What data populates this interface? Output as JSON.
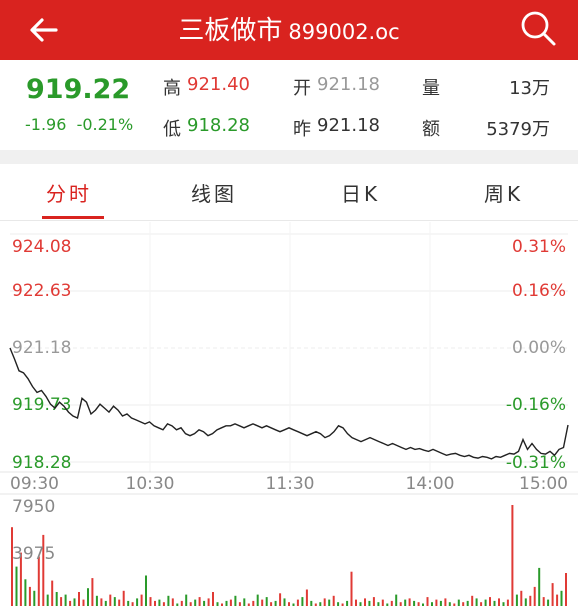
{
  "header": {
    "name": "三板做市",
    "code": "899002.oc"
  },
  "quote": {
    "price": "919.22",
    "change": "-1.96",
    "change_pct": "-0.21%",
    "high_label": "高",
    "high": "921.40",
    "low_label": "低",
    "low": "918.28",
    "open_label": "开",
    "open": "921.18",
    "prev_label": "昨",
    "prev": "921.18",
    "volume_label": "量",
    "volume": "13万",
    "amount_label": "额",
    "amount": "5379万"
  },
  "tabs": [
    {
      "label": "分时",
      "active": true
    },
    {
      "label": "线图",
      "active": false
    },
    {
      "label": "日K",
      "active": false
    },
    {
      "label": "周K",
      "active": false
    }
  ],
  "colors": {
    "brand": "#d9231f",
    "up": "#e03a35",
    "down": "#2a9a2a"
  },
  "chart_data": {
    "type": "line",
    "y_left_ticks": [
      "924.08",
      "922.63",
      "921.18",
      "919.73",
      "918.28"
    ],
    "y_right_ticks": [
      "0.31%",
      "0.16%",
      "0.00%",
      "-0.16%",
      "-0.31%"
    ],
    "x_ticks": [
      "09:30",
      "10:30",
      "11:30",
      "14:00",
      "15:00"
    ],
    "ylim": [
      918.28,
      924.08
    ],
    "price": [
      921.18,
      920.9,
      920.6,
      920.55,
      920.4,
      920.2,
      920.05,
      920.1,
      919.95,
      919.75,
      919.65,
      919.8,
      919.7,
      919.55,
      919.45,
      919.4,
      919.9,
      919.8,
      919.5,
      919.6,
      919.75,
      919.65,
      919.55,
      919.7,
      919.6,
      919.45,
      919.5,
      919.4,
      919.35,
      919.3,
      919.25,
      919.3,
      919.2,
      919.15,
      919.1,
      919.25,
      919.2,
      919.1,
      919.15,
      919.0,
      918.95,
      919.0,
      919.1,
      919.05,
      918.95,
      919.0,
      919.1,
      919.15,
      919.2,
      919.2,
      919.25,
      919.2,
      919.15,
      919.2,
      919.25,
      919.2,
      919.15,
      919.2,
      919.15,
      919.1,
      919.05,
      919.1,
      919.15,
      919.1,
      919.05,
      919.0,
      918.95,
      919.0,
      919.05,
      919.0,
      918.9,
      918.95,
      919.05,
      919.2,
      919.15,
      919.0,
      918.9,
      918.85,
      918.8,
      918.85,
      918.9,
      918.85,
      918.8,
      918.75,
      918.7,
      918.75,
      918.7,
      918.65,
      918.6,
      918.65,
      918.6,
      918.62,
      918.58,
      918.55,
      918.6,
      918.55,
      918.5,
      918.45,
      918.48,
      918.5,
      918.45,
      918.42,
      918.45,
      918.4,
      918.38,
      918.42,
      918.4,
      918.36,
      918.42,
      918.4,
      918.45,
      918.5,
      918.48,
      918.55,
      918.85,
      918.6,
      918.75,
      918.6,
      918.5,
      918.48,
      918.55,
      918.45,
      918.6,
      918.65,
      919.22
    ],
    "volume_ticks": [
      "7950",
      "3975"
    ],
    "volume_max": 7950,
    "volume": [
      6200,
      3100,
      4200,
      2100,
      1500,
      1200,
      3900,
      5600,
      900,
      2000,
      1100,
      700,
      900,
      400,
      600,
      1100,
      500,
      1400,
      2200,
      800,
      600,
      400,
      900,
      700,
      500,
      1200,
      400,
      300,
      600,
      900,
      2400,
      700,
      400,
      500,
      300,
      800,
      600,
      200,
      400,
      900,
      300,
      500,
      700,
      400,
      600,
      1100,
      300,
      200,
      400,
      500,
      800,
      300,
      600,
      200,
      400,
      900,
      500,
      700,
      300,
      400,
      1000,
      600,
      300,
      200,
      500,
      700,
      1300,
      400,
      200,
      300,
      600,
      500,
      800,
      300,
      200,
      400,
      2700,
      500,
      300,
      600,
      400,
      700,
      300,
      500,
      200,
      400,
      900,
      300,
      500,
      600,
      400,
      300,
      200,
      700,
      300,
      500,
      400,
      600,
      300,
      200,
      500,
      300,
      400,
      800,
      600,
      300,
      500,
      700,
      400,
      600,
      300,
      500,
      7950,
      900,
      1200,
      600,
      800,
      1500,
      3000,
      700,
      500,
      1800,
      900,
      1200,
      2600
    ],
    "volume_up": [
      true,
      false,
      true,
      false,
      true,
      false,
      true,
      true,
      false,
      true,
      false,
      true,
      false,
      true,
      false,
      true,
      true,
      false,
      true,
      false,
      true,
      false,
      true,
      false,
      true,
      true,
      false,
      true,
      false,
      true,
      false,
      true,
      true,
      false,
      true,
      false,
      true,
      false,
      true,
      false,
      true,
      false,
      true,
      false,
      true,
      true,
      false,
      true,
      false,
      true,
      false,
      true,
      false,
      true,
      true,
      false,
      true,
      false,
      true,
      false,
      true,
      false,
      true,
      false,
      true,
      false,
      true,
      false,
      true,
      false,
      true,
      false,
      true,
      false,
      true,
      false,
      true,
      true,
      false,
      true,
      false,
      true,
      false,
      true,
      false,
      true,
      false,
      true,
      false,
      true,
      false,
      true,
      false,
      true,
      false,
      true,
      false,
      true,
      false,
      true,
      false,
      true,
      false,
      true,
      false,
      true,
      false,
      true,
      false,
      true,
      false,
      true,
      true,
      false,
      true,
      false,
      true,
      true,
      false,
      true,
      false,
      true,
      true,
      false,
      true
    ]
  }
}
